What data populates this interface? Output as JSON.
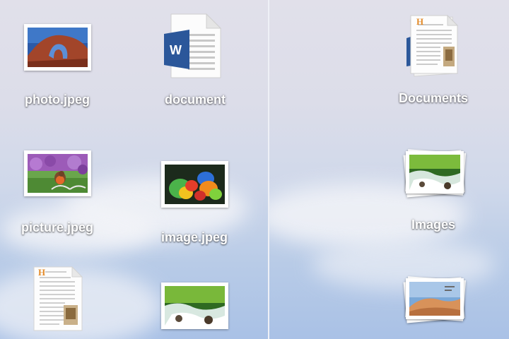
{
  "files": {
    "photo": {
      "label": "photo.jpeg",
      "icon": "photo-thumbnail-icon"
    },
    "document": {
      "label": "document",
      "icon": "word-document-icon",
      "badge_letter": "W"
    },
    "picture": {
      "label": "picture.jpeg",
      "icon": "bird-photo-thumbnail-icon"
    },
    "image": {
      "label": "image.jpeg",
      "icon": "parrots-photo-thumbnail-icon"
    },
    "text_doc": {
      "icon": "text-document-icon",
      "initial": "H"
    },
    "waterfall": {
      "icon": "waterfall-photo-thumbnail-icon"
    }
  },
  "folders": {
    "documents": {
      "label": "Documents",
      "icon": "documents-stack-icon",
      "initial": "H"
    },
    "images": {
      "label": "Images",
      "icon": "images-stack-icon"
    },
    "desert": {
      "icon": "desert-images-stack-icon"
    }
  },
  "colors": {
    "label_text": "#ffffff",
    "word_blue": "#2b579a",
    "sky_top": "#e1e0ea",
    "sky_bottom": "#a9c1e6"
  }
}
